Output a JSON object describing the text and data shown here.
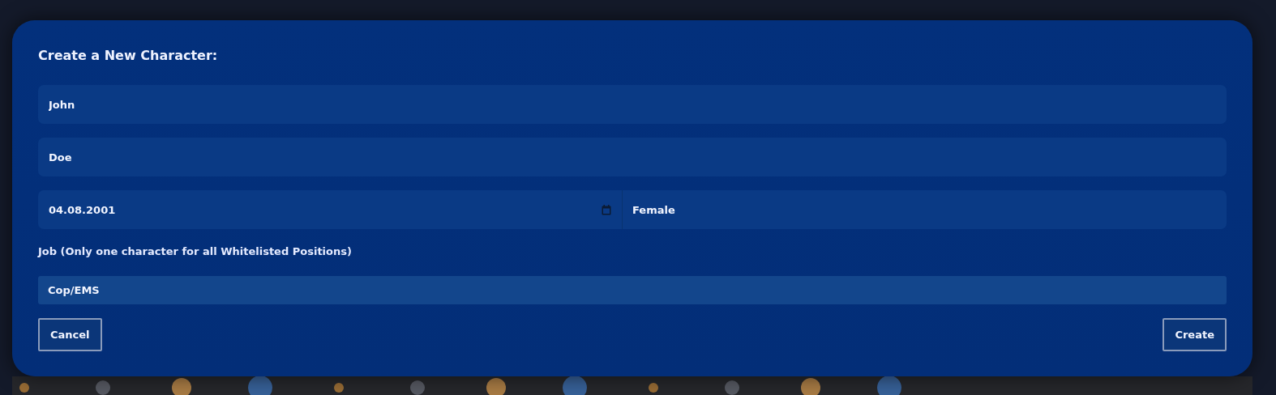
{
  "dialog": {
    "title": "Create a New Character:",
    "first_name": {
      "value": "John"
    },
    "last_name": {
      "value": "Doe"
    },
    "birth_date": {
      "value": "04.08.2001"
    },
    "gender": {
      "value": "Female"
    },
    "job": {
      "label": "Job (Only one character for all Whitelisted Positions)",
      "value": "Cop/EMS"
    },
    "buttons": [
      {
        "kind": "cancel",
        "label": "Cancel"
      },
      {
        "kind": "create",
        "label": "Create"
      }
    ]
  }
}
